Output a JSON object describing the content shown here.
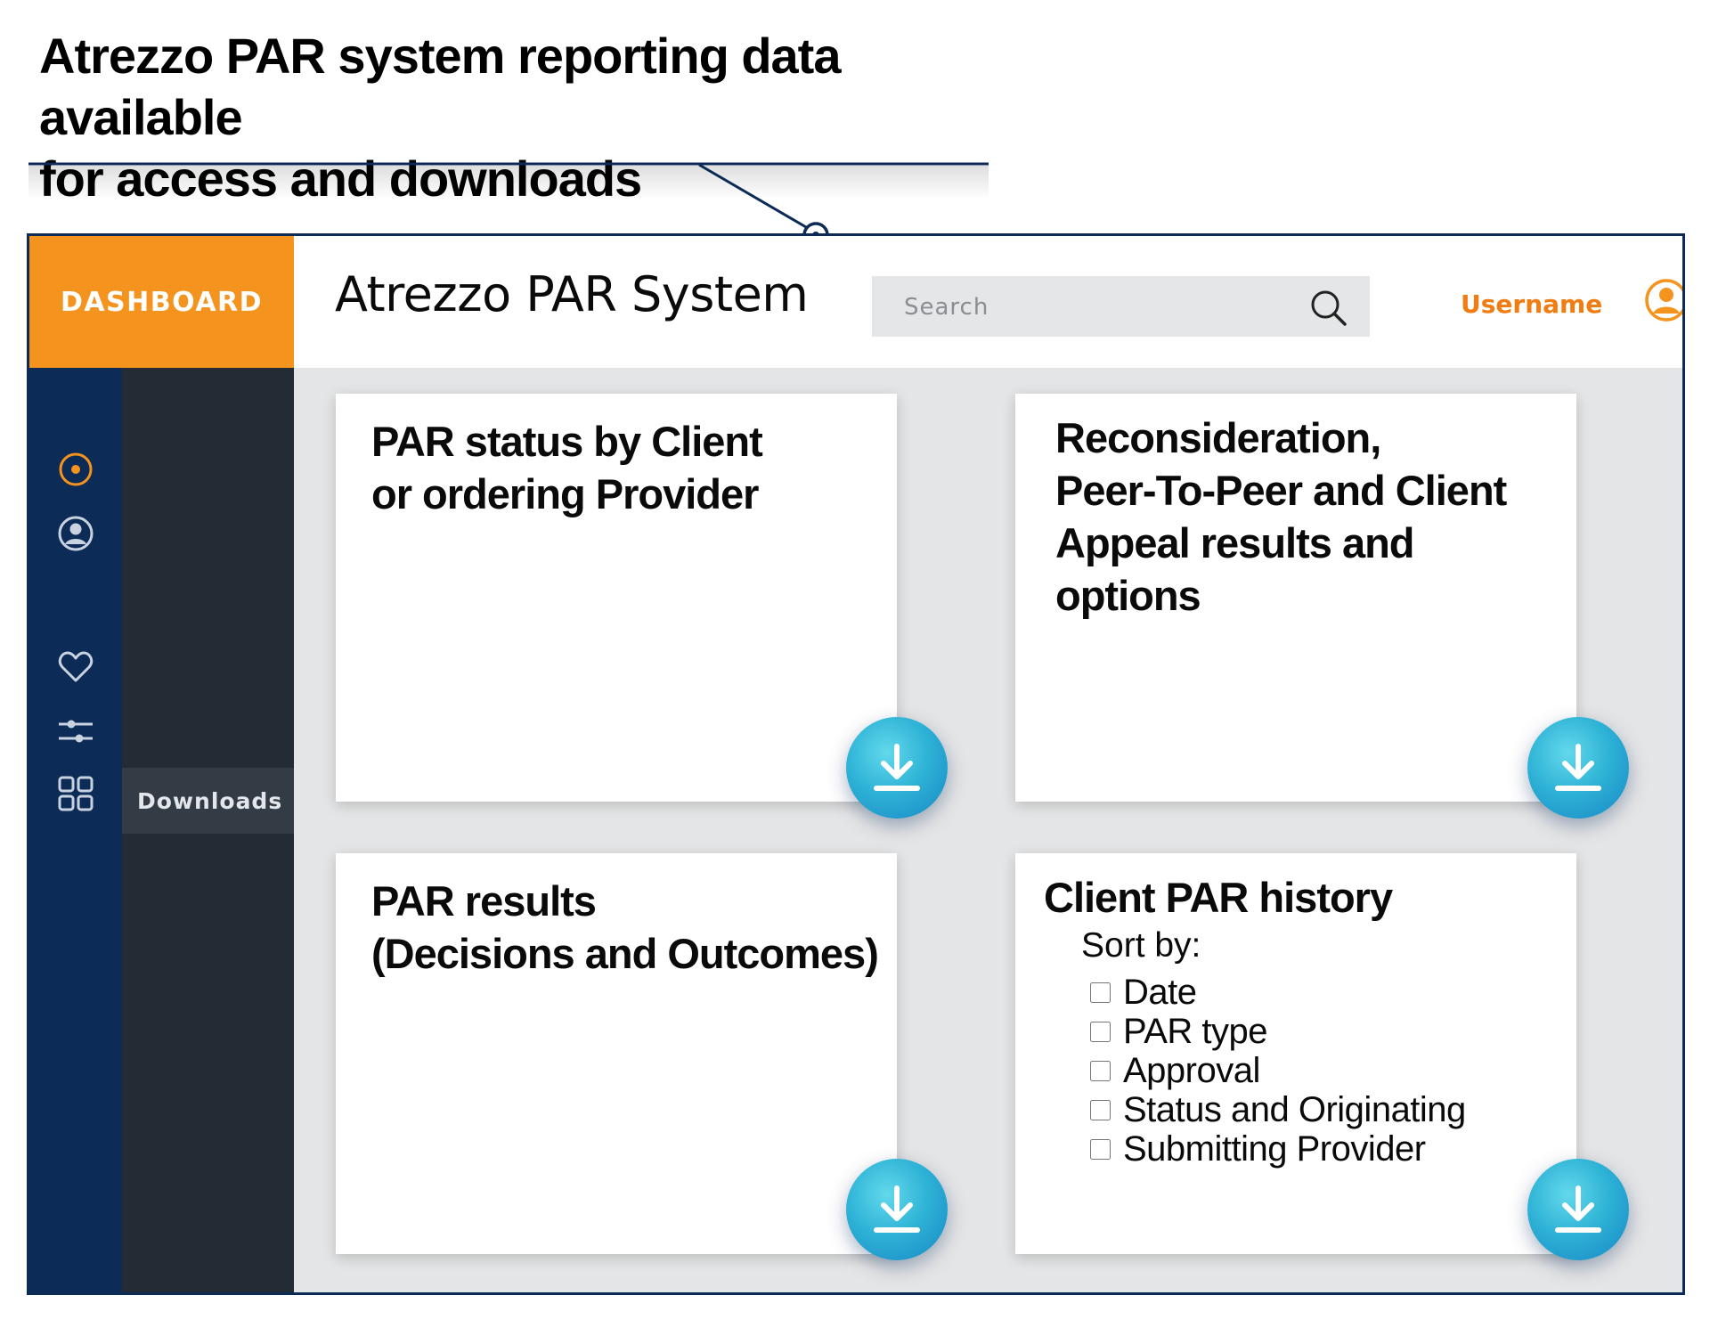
{
  "callout": {
    "line1": "Atrezzo PAR system reporting data available",
    "line2": "for access and downloads"
  },
  "header": {
    "brand_label": "DASHBOARD",
    "app_title": "Atrezzo PAR System",
    "search_placeholder": "Search",
    "username": "Username"
  },
  "colors": {
    "accent": "#f5931f",
    "rail": "#0c2b56",
    "subnav": "#232b35",
    "download_button": "#2fb3d6"
  },
  "rail": {
    "icons": [
      "target-icon",
      "user-circle-icon",
      "heart-icon",
      "sliders-icon",
      "grid-icon"
    ]
  },
  "subnav": {
    "items": [
      {
        "label": "Downloads",
        "active": true
      }
    ]
  },
  "cards": [
    {
      "title_lines": [
        "PAR status by Client",
        "or ordering Provider"
      ],
      "action_icon": "download-icon"
    },
    {
      "title_lines": [
        "Reconsideration,",
        "Peer-To-Peer and Client",
        "Appeal results and",
        "options"
      ],
      "action_icon": "download-icon"
    },
    {
      "title_lines": [
        "PAR results",
        "(Decisions and Outcomes)"
      ],
      "action_icon": "download-icon"
    },
    {
      "title_lines": [
        "Client PAR history"
      ],
      "sort_label": "Sort by:",
      "sort_options": [
        {
          "label": "Date",
          "checked": false
        },
        {
          "label": "PAR type",
          "checked": false
        },
        {
          "label": "Approval",
          "checked": false
        },
        {
          "label": "Status and Originating",
          "checked": false
        },
        {
          "label": "Submitting Provider",
          "checked": false
        }
      ],
      "action_icon": "download-icon"
    }
  ]
}
